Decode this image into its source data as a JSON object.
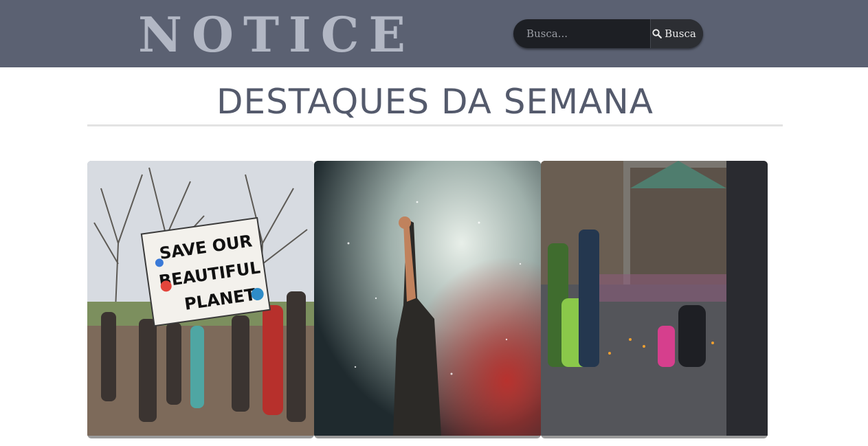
{
  "header": {
    "logo_text": "NOTICE",
    "search": {
      "placeholder": "Busca...",
      "button_label": "Busca",
      "button_icon": "search-icon"
    }
  },
  "main": {
    "section_title": "DESTAQUES DA SEMANA",
    "featured": [
      {
        "banner_lines": [
          "SAVE OUR",
          "BEAUTIFUL",
          "PLANET"
        ]
      },
      {},
      {}
    ]
  },
  "colors": {
    "header_bg": "#5b6172",
    "logo": "#b2b7c4",
    "title": "#545a6c",
    "search_bg": "#1d1f24"
  }
}
